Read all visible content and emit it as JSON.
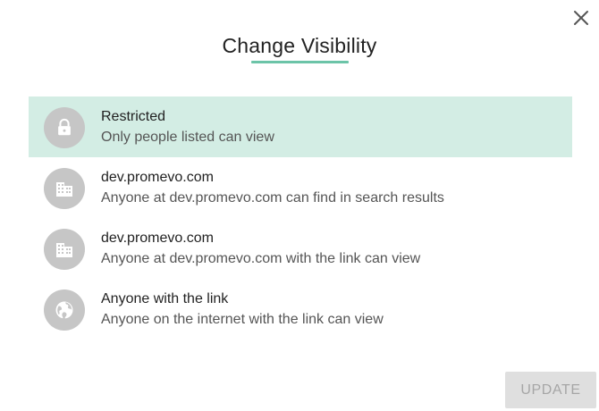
{
  "dialog": {
    "title": "Change Visibility",
    "close_icon": "close-icon",
    "accent_color": "#6cc4a8",
    "selected_bg": "#d3ede4"
  },
  "options": [
    {
      "title": "Restricted",
      "description": "Only people listed can view",
      "icon": "lock-icon",
      "selected": true
    },
    {
      "title": "dev.promevo.com",
      "description": "Anyone at dev.promevo.com can find in search results",
      "icon": "building-icon",
      "selected": false
    },
    {
      "title": "dev.promevo.com",
      "description": "Anyone at dev.promevo.com with the link can view",
      "icon": "building-icon",
      "selected": false
    },
    {
      "title": "Anyone with the link",
      "description": "Anyone on the internet with the link can view",
      "icon": "globe-icon",
      "selected": false
    }
  ],
  "footer": {
    "update_label": "UPDATE",
    "update_disabled": true
  }
}
